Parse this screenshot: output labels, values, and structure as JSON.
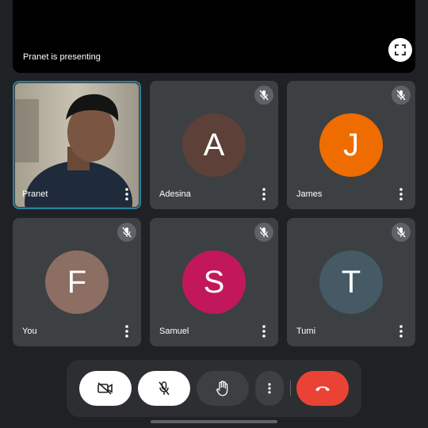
{
  "presentation": {
    "label": "Pranet is presenting",
    "fullscreen_icon": "fullscreen-icon"
  },
  "participants": [
    {
      "name": "Pranet",
      "video_on": true,
      "muted": false
    },
    {
      "name": "Adesina",
      "initial": "A",
      "color": "#5d4037",
      "muted": true
    },
    {
      "name": "James",
      "initial": "J",
      "color": "#ef6c00",
      "muted": true
    },
    {
      "name": "You",
      "initial": "F",
      "color": "#8d6e63",
      "muted": true
    },
    {
      "name": "Samuel",
      "initial": "S",
      "color": "#c2185b",
      "muted": true
    },
    {
      "name": "Tumi",
      "initial": "T",
      "color": "#455a64",
      "muted": true
    }
  ],
  "toolbar": {
    "camera_icon": "camera-off-icon",
    "mic_icon": "mic-off-icon",
    "raise_hand_icon": "raise-hand-icon",
    "more_icon": "more-vert-icon",
    "hangup_icon": "call-end-icon",
    "hangup_color": "#ea4335"
  },
  "colors": {
    "background": "#202124",
    "tile": "#3c4043",
    "active_outline": "#2a7f9a"
  }
}
